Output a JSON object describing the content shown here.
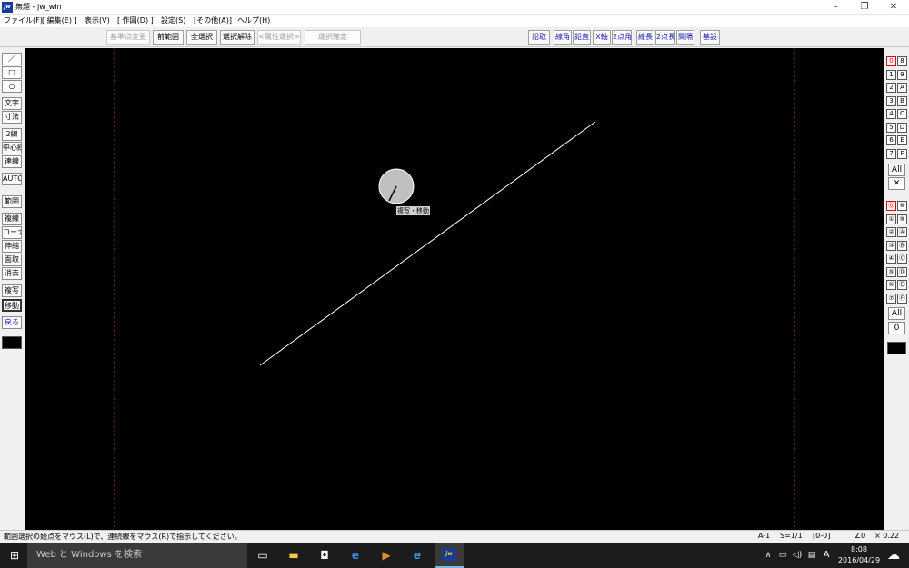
{
  "window": {
    "title": "無題 - jw_win",
    "icon": "jw",
    "minimize": "–",
    "restore": "❐",
    "close": "✕"
  },
  "menu": [
    "ファイル(F)",
    "[ 編集(E) ]",
    "表示(V)",
    "[ 作図(D) ]",
    "設定(S)",
    "[その他(A)]",
    "ヘルプ(H)"
  ],
  "toolbar_left": [
    "基準点変更",
    "前範囲",
    "全選択",
    "選択解除",
    "<属性選択>",
    "選択確定"
  ],
  "toolbar_right": [
    "鉛取",
    "線角",
    "鉛直",
    "X軸",
    "2点角",
    "線長",
    "2点長",
    "間隔",
    "基設"
  ],
  "left_tools": [
    "／",
    "□",
    "○",
    "文字",
    "寸法",
    "2線",
    "中心線",
    "連線",
    "AUTO",
    "範囲",
    "複線",
    "コーナー",
    "伸縮",
    "面取",
    "消去",
    "複写",
    "移動",
    "戻る"
  ],
  "layers_a": [
    "0",
    "8",
    "1",
    "9",
    "2",
    "A",
    "3",
    "B",
    "4",
    "C",
    "5",
    "D",
    "6",
    "E",
    "7",
    "F"
  ],
  "layers_b": [
    "⓪",
    "⑧",
    "①",
    "⑨",
    "②",
    "Ⓐ",
    "③",
    "Ⓑ",
    "④",
    "Ⓒ",
    "⑤",
    "Ⓓ",
    "⑥",
    "Ⓔ",
    "⑦",
    "Ⓕ"
  ],
  "right_all": "All",
  "right_x": "✕",
  "right_all2": "All",
  "right_zero": "0",
  "canvas": {
    "cursor_label": "複写・移動"
  },
  "status": {
    "message": "範囲選択の始点をマウス(L)で、連続線をマウス(R)で指示してください。",
    "paper": "A-1",
    "scale": "S=1/1",
    "layer": "[0-0]",
    "angle": "∠0",
    "zoom": "× 0.22"
  },
  "taskbar": {
    "search": "Web と Windows を検索",
    "time": "8:08",
    "date": "2016/04/29",
    "ime": "A"
  }
}
